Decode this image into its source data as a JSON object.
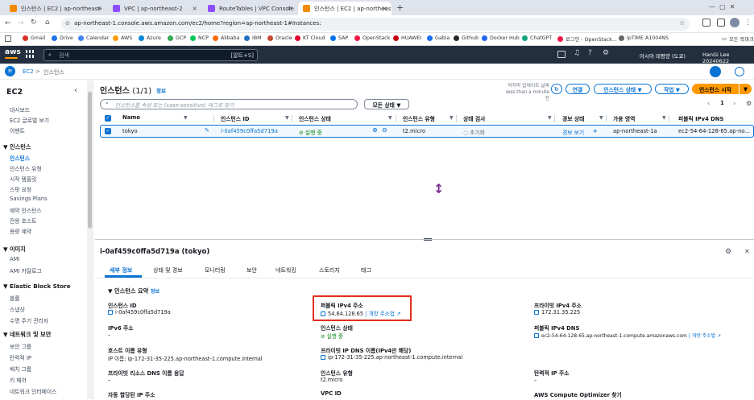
{
  "browser": {
    "tabs": [
      {
        "label": "인스턴스 | EC2 | ap-northeast-",
        "color": "#f28b00"
      },
      {
        "label": "VPC | ap-northeast-2",
        "color": "#8c4fff"
      },
      {
        "label": "RouteTables | VPC Console",
        "color": "#8c4fff"
      },
      {
        "label": "인스턴스 | EC2 | ap-northeast-",
        "color": "#f28b00"
      }
    ],
    "new_tab": "+",
    "url": "ap-northeast-1.console.aws.amazon.com/ec2/home?region=ap-northeast-1#Instances:",
    "bookmarks": [
      "Gmail",
      "Drive",
      "Calendar",
      "AWS",
      "Azure",
      "GCP",
      "NCP",
      "Alibaba",
      "IBM",
      "Oracle",
      "KT Cloud",
      "SAP",
      "OpenStack",
      "HUAWEI",
      "Gabia",
      "Github",
      "Docker Hub",
      "ChatGPT",
      "로그인 - OpenStack...",
      "IpTIME A1004NS"
    ],
    "bookmarks_folder": "모든 북마크"
  },
  "aws_nav": {
    "logo": "aws",
    "search_placeholder": "검색",
    "search_shortcut": "[알트+S]",
    "region": "아시아 태평양 (도쿄)",
    "user": "HanGi Lee 20240622"
  },
  "breadcrumb": {
    "service": "EC2",
    "sep": ">",
    "current": "인스턴스"
  },
  "sidebar": {
    "title": "EC2",
    "top_items": [
      "대시보드",
      "EC2 글로벌 보기",
      "이벤트"
    ],
    "sections": [
      {
        "title": "▼ 인스턴스",
        "items": [
          "인스턴스",
          "인스턴스 유형",
          "시작 템플릿",
          "스팟 요청",
          "Savings Plans",
          "예약 인스턴스",
          "전용 호스트",
          "용량 예약"
        ]
      },
      {
        "title": "▼ 이미지",
        "items": [
          "AMI",
          "AMI 카탈로그"
        ]
      },
      {
        "title": "▼ Elastic Block Store",
        "items": [
          "볼륨",
          "스냅샷",
          "수명 주기 관리자"
        ]
      },
      {
        "title": "▼ 네트워크 및 보안",
        "items": [
          "보안 그룹",
          "탄력적 IP",
          "배치 그룹",
          "키 페어",
          "네트워크 인터페이스"
        ]
      }
    ]
  },
  "instances": {
    "title": "인스턴스",
    "count": "(1/1)",
    "info": "정보",
    "last_updated": "마지막 업데이트 날짜",
    "last_updated_time": "less than a minute 전",
    "connect": "연결",
    "state_btn": "인스턴스 상태 ▼",
    "actions_btn": "작업 ▼",
    "launch_btn": "인스턴스 시작",
    "filter_placeholder": "인스턴스를 속성 또는 (case-sensitive) 태그로 찾기",
    "state_filter": "모든 상태 ▼",
    "page": "1",
    "columns": [
      "Name",
      "인스턴스 ID",
      "인스턴스 상태",
      "인스턴스 유형",
      "상태 검사",
      "경보 상태",
      "가용 영역",
      "퍼블릭 IPv4 DNS"
    ],
    "row": {
      "name": "tokyo",
      "id": "i-0af459c0ffa5d719a",
      "state": "실행 중",
      "type": "t2.micro",
      "check": "초기화",
      "alarm": "경보 보기",
      "alarm_add": "+",
      "az": "ap-northeast-1a",
      "dns": "ec2-54-64-128-65.ap-no..."
    }
  },
  "detail": {
    "title": "i-0af459c0ffa5d719a (tokyo)",
    "tabs": [
      "세부 정보",
      "상태 및 경보",
      "모니터링",
      "보안",
      "네트워킹",
      "스토리지",
      "태그"
    ],
    "summary_title": "▼ 인스턴스 요약",
    "summary_info": "정보",
    "fields": {
      "instance_id_label": "인스턴스 ID",
      "instance_id": "i-0af459c0ffa5d719a",
      "public_ipv4_label": "퍼블릭 IPv4 주소",
      "public_ipv4": "54.64.128.65",
      "public_ipv4_link": "| 개방 주소법",
      "private_ipv4_label": "프라이빗 IPv4 주소",
      "private_ipv4": "172.31.35.225",
      "ipv6_label": "IPv6 주소",
      "ipv6": "–",
      "state_label": "인스턴스 상태",
      "state": "실행 중",
      "public_dns_label": "퍼블릭 IPv4 DNS",
      "public_dns": "ec2-54-64-128-65.ap-northeast-1.compute.amazonaws.com",
      "public_dns_link": "| 개방 주소법",
      "hostname_type_label": "호스트 이름 유형",
      "hostname_type": "IP 이름: ip-172-31-35-225.ap-northeast-1.compute.internal",
      "private_dns_label": "프라이빗 IP DNS 이름(IPv4만 해당)",
      "private_dns": "ip-172-31-35-225.ap-northeast-1.compute.internal",
      "resource_dns_label": "프라이빗 리소스 DNS 이름 응답",
      "resource_dns": "–",
      "instance_type_label": "인스턴스 유형",
      "instance_type": "t2.micro",
      "elastic_ip_label": "탄력적 IP 주소",
      "elastic_ip": "–",
      "auto_ip_label": "자동 할당된 IP 주소",
      "vpc_label": "VPC ID",
      "optimizer_label": "AWS Compute Optimizer 찾기"
    }
  },
  "colors": {
    "aws_dark": "#232f3e",
    "link": "#0972d3",
    "orange": "#ff9900",
    "success": "#037f0c",
    "highlight": "#e0301e"
  }
}
